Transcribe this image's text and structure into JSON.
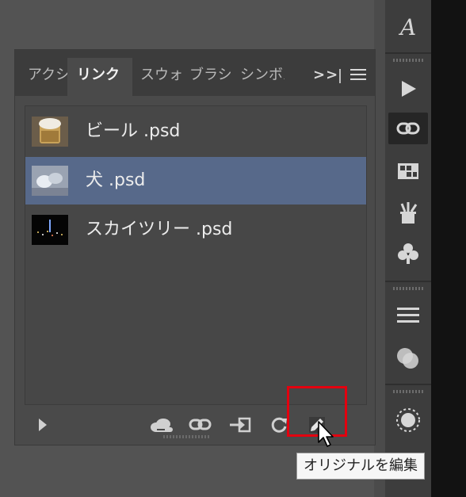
{
  "panel": {
    "tabs": [
      {
        "label": "アクション",
        "active": false
      },
      {
        "label": "リンク",
        "active": true
      },
      {
        "label": "スウォッチ",
        "active": false
      },
      {
        "label": "ブラシ",
        "active": false
      },
      {
        "label": "シンボル",
        "active": false
      }
    ],
    "more_label": ">>",
    "links": [
      {
        "name": "ビール .psd",
        "selected": false,
        "thumb": "beer-thumbnail"
      },
      {
        "name": "犬 .psd",
        "selected": true,
        "thumb": "dog-thumbnail"
      },
      {
        "name": "スカイツリー .psd",
        "selected": false,
        "thumb": "skytree-thumbnail"
      }
    ],
    "footer_icons": [
      "show-link-info-icon",
      "cc-library-icon",
      "relink-icon",
      "embed-icon",
      "update-link-icon",
      "edit-original-icon"
    ]
  },
  "tooltip": {
    "text": "オリジナルを編集"
  },
  "dock_icons": [
    "character-styles-icon",
    "actions-play-icon",
    "links-icon",
    "swatches-icon",
    "brushes-icon",
    "symbols-icon",
    "align-icon",
    "pathfinder-icon",
    "appearance-icon"
  ],
  "colors": {
    "selection": "#57698a",
    "highlight_box": "#e3000f",
    "panel_bg": "#4a4a4a"
  }
}
